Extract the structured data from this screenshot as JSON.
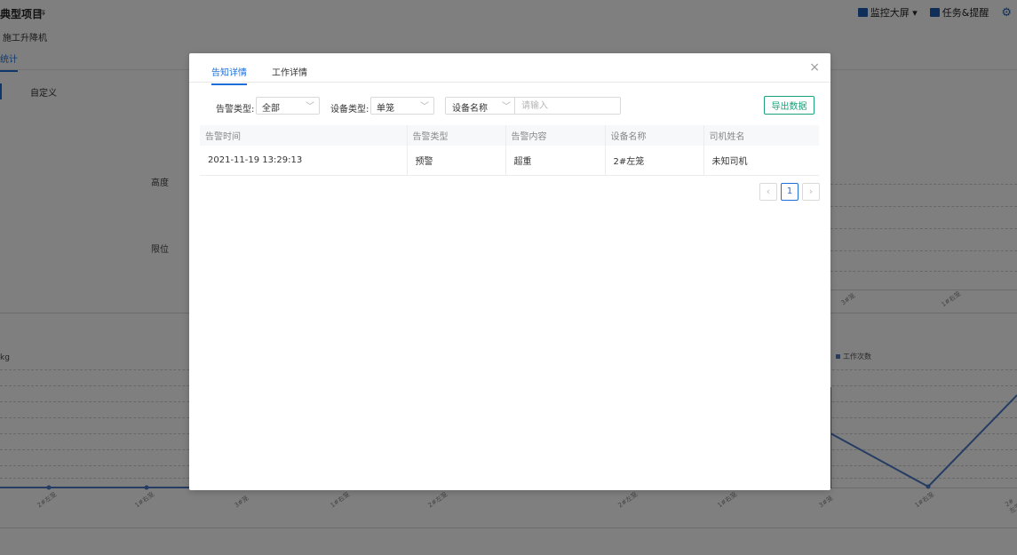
{
  "background": {
    "project_title": "典型项目",
    "title_icon": "⇆",
    "subtitle": "施工升降机",
    "active_tab": "统计",
    "custom_label": "自定义",
    "monitor_label": "监控大屏",
    "tasks_label": "任务&提醒",
    "left_labels": [
      "高度",
      "限位"
    ],
    "unit_label": "kg",
    "legend_label": "工作次数",
    "tick_labels": [
      "2#左笼",
      "1#右笼",
      "3#笼",
      "1#右笼",
      "2#左笼",
      "2#左笼",
      "1#右笼",
      "3#笼",
      "1#右笼",
      "2#左笼"
    ],
    "top_tick_labels": [
      "3#笼",
      "1#右笼"
    ]
  },
  "modal": {
    "tabs": [
      {
        "label": "告知详情",
        "active": true
      },
      {
        "label": "工作详情",
        "active": false
      }
    ],
    "close_glyph": "×",
    "filters": {
      "alarm_type_label": "告警类型:",
      "alarm_type_value": "全部",
      "device_type_label": "设备类型:",
      "device_type_value": "单笼",
      "search_field_value": "设备名称",
      "search_placeholder": "请输入"
    },
    "export_label": "导出数据",
    "table": {
      "headers": [
        "告警时间",
        "告警类型",
        "告警内容",
        "设备名称",
        "司机姓名"
      ],
      "rows": [
        [
          "2021-11-19 13:29:13",
          "预警",
          "超重",
          "2#左笼",
          "未知司机"
        ]
      ]
    },
    "pagination": {
      "prev": "‹",
      "current": "1",
      "next": "›"
    }
  },
  "colors": {
    "accent": "#1e6fd9",
    "export": "#1aa37a",
    "line": "#4a78c6"
  }
}
